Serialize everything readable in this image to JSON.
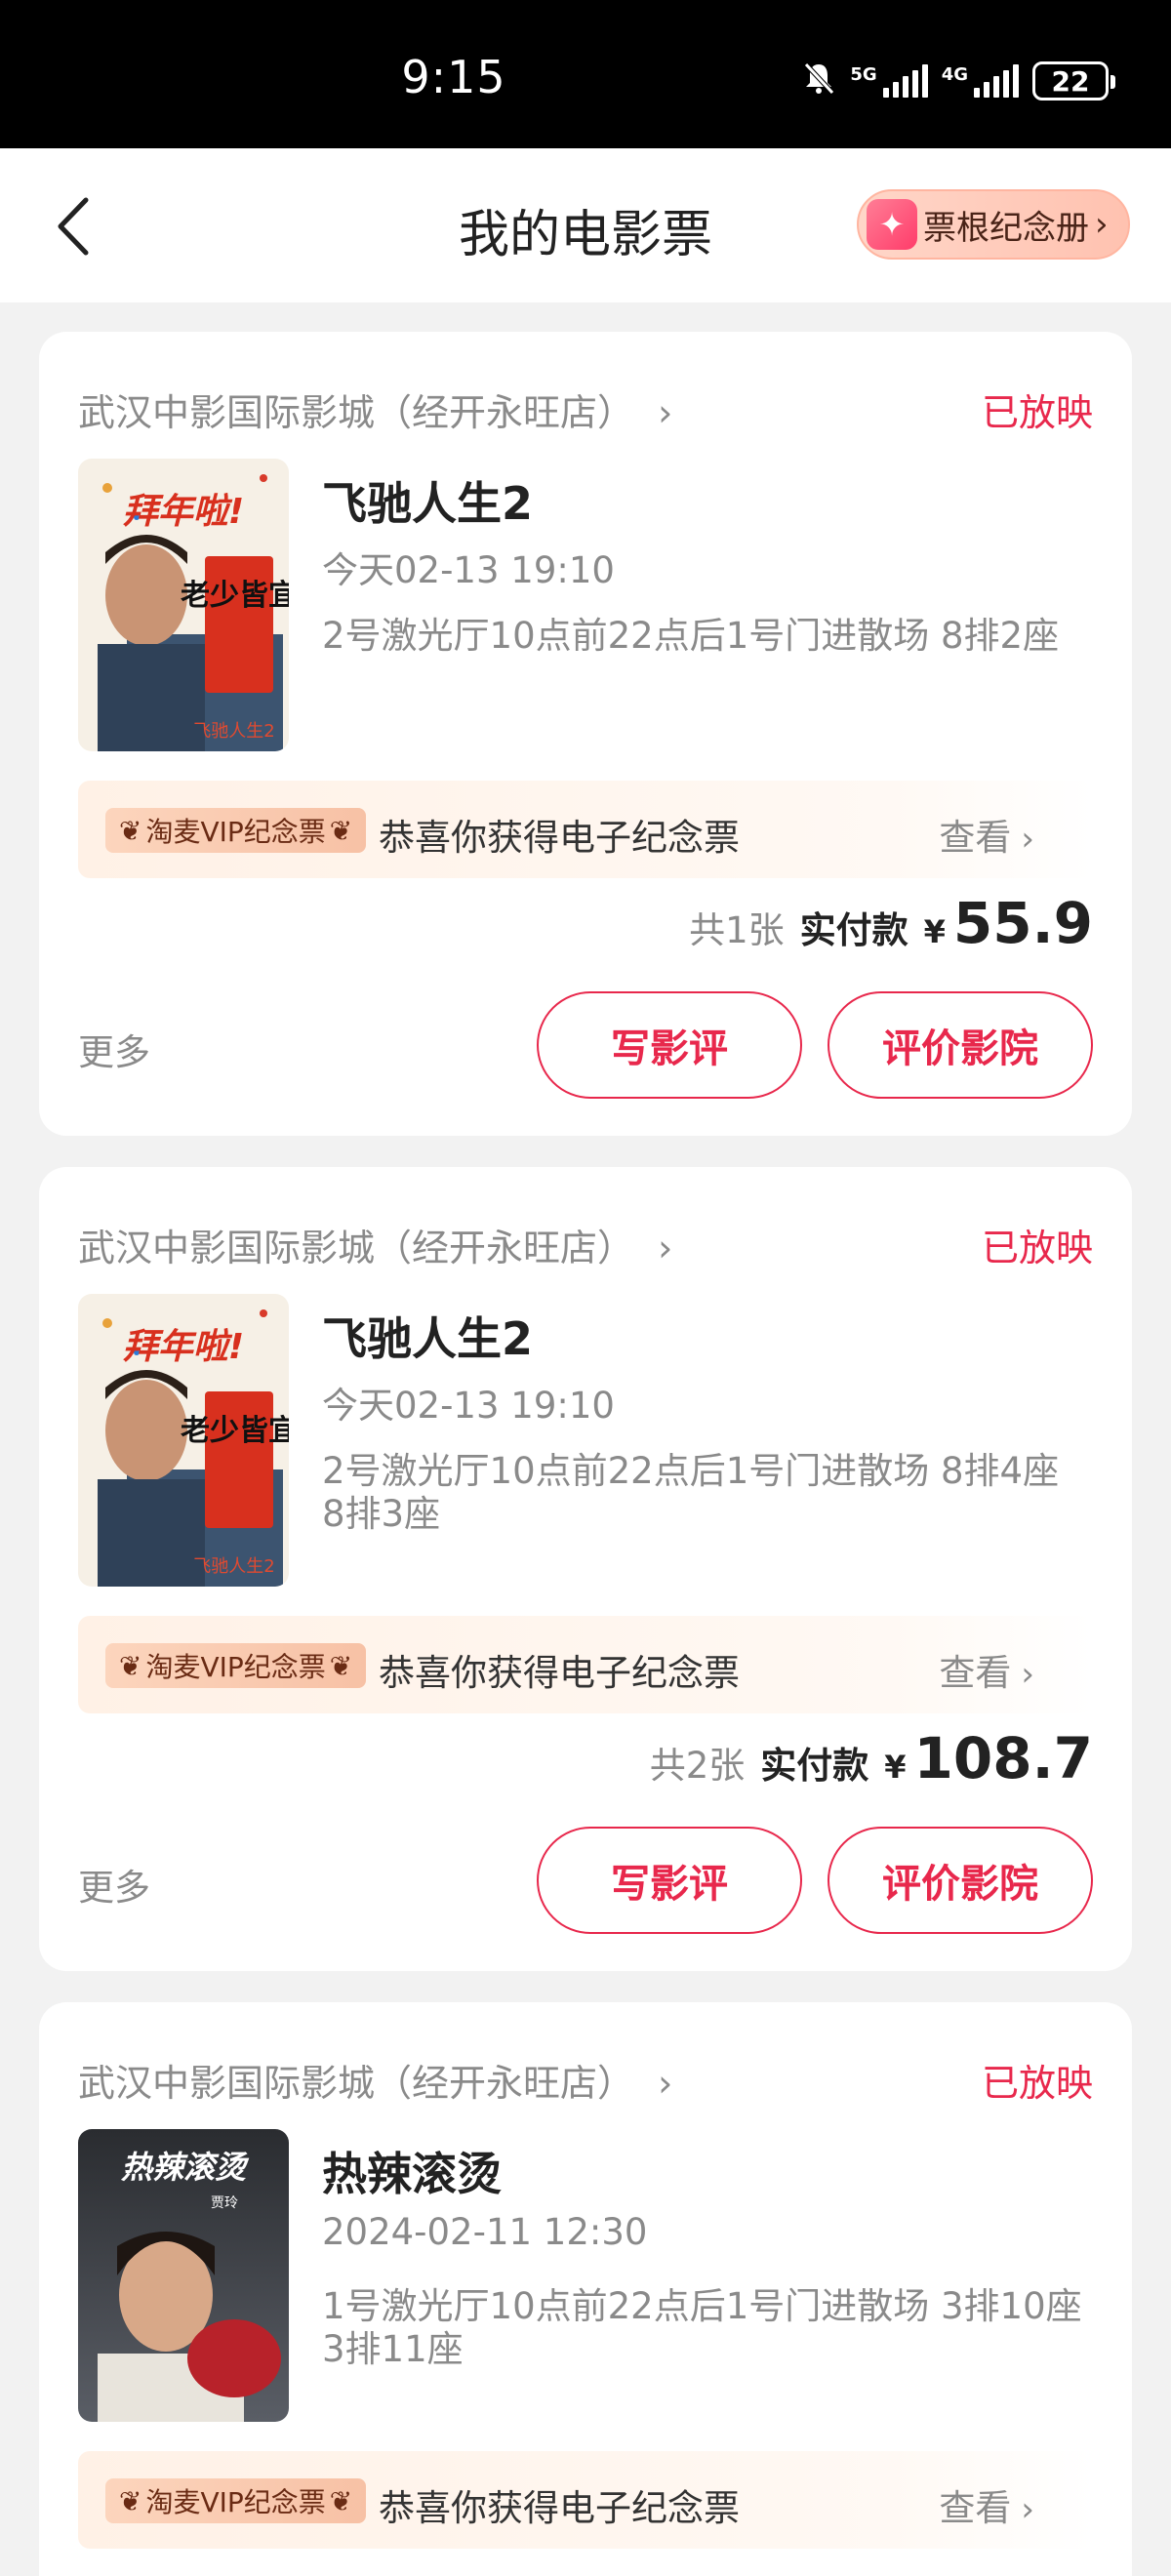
{
  "status_bar": {
    "time": "9:15",
    "battery": "22",
    "network1": "5G",
    "network2": "4G"
  },
  "header": {
    "title": "我的电影票",
    "album_label": "票根纪念册"
  },
  "tickets": [
    {
      "cinema": "武汉中影国际影城（经开永旺店）",
      "status": "已放映",
      "movie": "飞驰人生2",
      "showtime": "今天02-13 19:10",
      "seats": "2号激光厅10点前22点后1号门进散场 8排2座",
      "vip_tag": "淘麦VIP纪念票",
      "souvenir_text": "恭喜你获得电子纪念票",
      "view_label": "查看",
      "count": "共1张",
      "paid_label": "实付款",
      "currency": "¥",
      "price": "55.9",
      "more": "更多",
      "review_btn": "写影评",
      "rate_btn": "评价影院",
      "poster": {
        "banner": "拜年啦!",
        "sign": "老少皆宜",
        "small": "飞驰人生2"
      }
    },
    {
      "cinema": "武汉中影国际影城（经开永旺店）",
      "status": "已放映",
      "movie": "飞驰人生2",
      "showtime": "今天02-13 19:10",
      "seats": "2号激光厅10点前22点后1号门进散场 8排4座 8排3座",
      "vip_tag": "淘麦VIP纪念票",
      "souvenir_text": "恭喜你获得电子纪念票",
      "view_label": "查看",
      "count": "共2张",
      "paid_label": "实付款",
      "currency": "¥",
      "price": "108.7",
      "more": "更多",
      "review_btn": "写影评",
      "rate_btn": "评价影院",
      "poster": {
        "banner": "拜年啦!",
        "sign": "老少皆宜",
        "small": "飞驰人生2"
      }
    },
    {
      "cinema": "武汉中影国际影城（经开永旺店）",
      "status": "已放映",
      "movie": "热辣滚烫",
      "showtime": "2024-02-11 12:30",
      "seats": "1号激光厅10点前22点后1号门进散场 3排10座 3排11座",
      "vip_tag": "淘麦VIP纪念票",
      "souvenir_text": "恭喜你获得电子纪念票",
      "view_label": "查看",
      "poster": {
        "banner": "热辣滚烫",
        "sign": "贾玲"
      }
    }
  ],
  "colors": {
    "accent": "#e8284c",
    "muted": "#8a8a8a",
    "background": "#f2f2f2"
  }
}
